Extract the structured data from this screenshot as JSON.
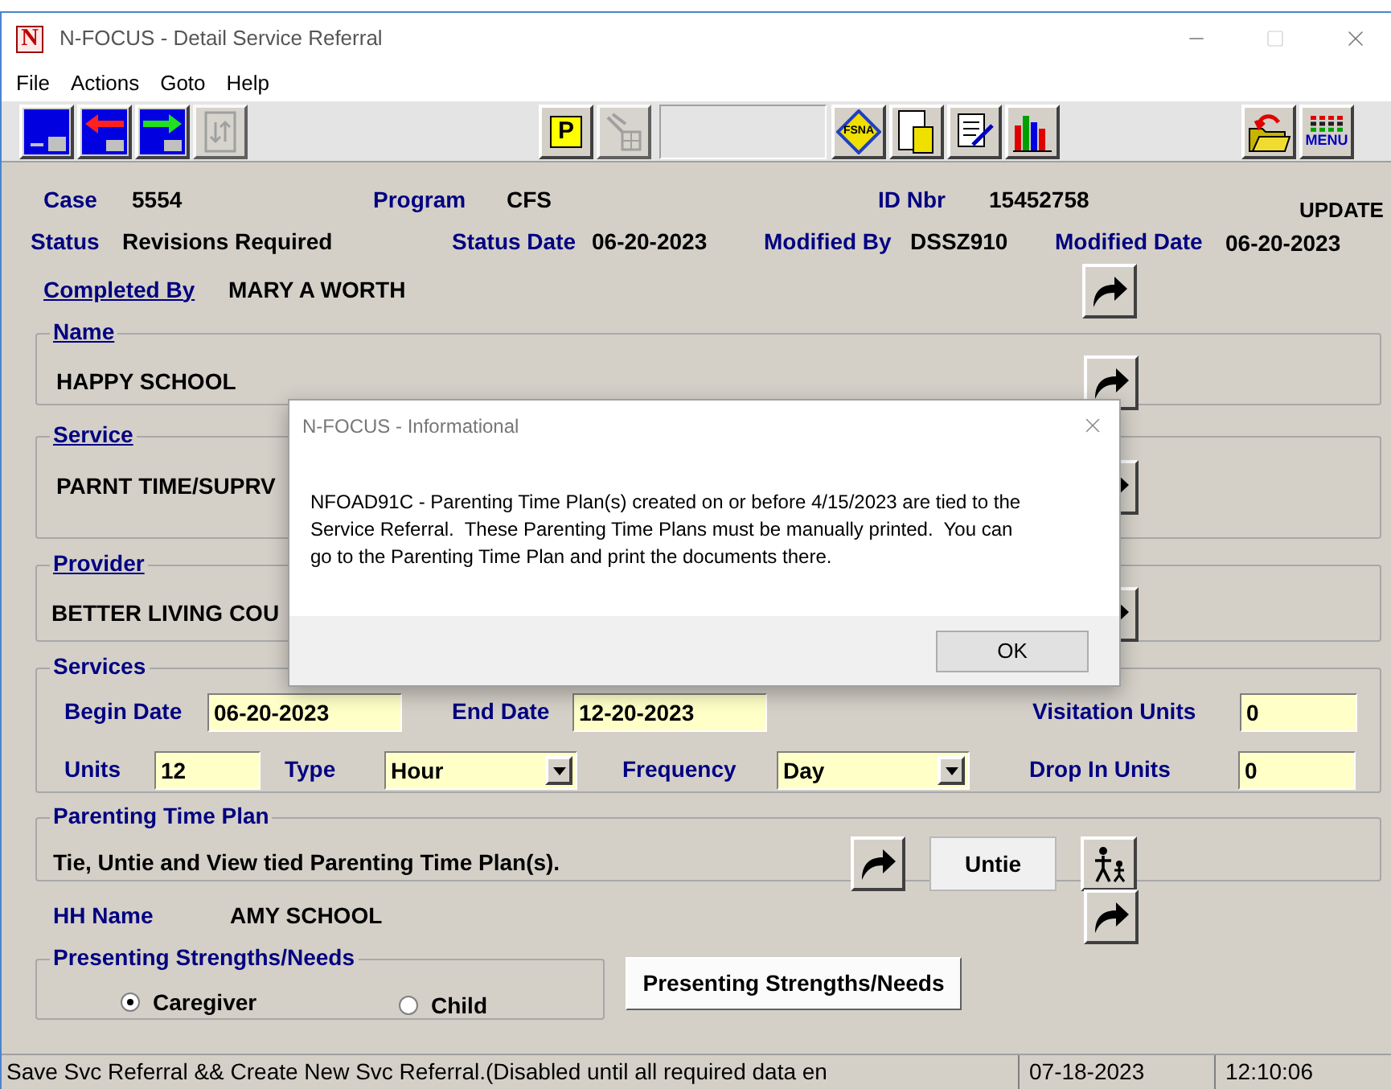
{
  "window": {
    "logo": "N",
    "title": "N-FOCUS - Detail Service Referral"
  },
  "menu": [
    {
      "label": "File"
    },
    {
      "label": "Actions"
    },
    {
      "label": "Goto"
    },
    {
      "label": "Help"
    }
  ],
  "toolbar": {
    "left": [
      {
        "kind": "save",
        "disabled": false
      },
      {
        "kind": "back",
        "disabled": false
      },
      {
        "kind": "forward",
        "disabled": false
      },
      {
        "kind": "swap",
        "disabled": true
      }
    ],
    "middle": [
      {
        "kind": "letter",
        "label": "P",
        "disabled": false
      },
      {
        "kind": "tool",
        "disabled": true
      }
    ],
    "tools": [
      {
        "kind": "diamond",
        "label": "FSNA",
        "disabled": false
      },
      {
        "kind": "document",
        "disabled": false
      },
      {
        "kind": "checklist",
        "disabled": false
      },
      {
        "kind": "chart",
        "disabled": false
      }
    ],
    "right": [
      {
        "kind": "folder",
        "disabled": false
      },
      {
        "kind": "menu",
        "label": "MENU",
        "disabled": false
      }
    ]
  },
  "case": {
    "label": "Case",
    "value": "5554"
  },
  "program": {
    "label": "Program",
    "value": "CFS"
  },
  "id_nbr": {
    "label": "ID Nbr",
    "value": "15452758"
  },
  "mode": "UPDATE",
  "status": {
    "label": "Status",
    "value": "Revisions Required"
  },
  "status_date": {
    "label": "Status Date",
    "value": "06-20-2023"
  },
  "modified_by": {
    "label": "Modified By",
    "value": "DSSZ910"
  },
  "modified_date": {
    "label": "Modified Date",
    "value": "06-20-2023"
  },
  "completed_by": {
    "label": "Completed By",
    "value": "MARY A WORTH"
  },
  "name": {
    "label": "Name",
    "value": "HAPPY SCHOOL"
  },
  "service": {
    "label": "Service",
    "value": "PARNT TIME/SUPRV"
  },
  "provider": {
    "label": "Provider",
    "value": "BETTER LIVING COU"
  },
  "services": {
    "label": "Services",
    "begin_date": {
      "label": "Begin Date",
      "value": "06-20-2023"
    },
    "end_date": {
      "label": "End Date",
      "value": "12-20-2023"
    },
    "visitation_units": {
      "label": "Visitation Units",
      "value": "0"
    },
    "units": {
      "label": "Units",
      "value": "12"
    },
    "type": {
      "label": "Type",
      "value": "Hour"
    },
    "frequency": {
      "label": "Frequency",
      "value": "Day"
    },
    "drop_in_units": {
      "label": "Drop In Units",
      "value": "0"
    }
  },
  "parenting_time_plan": {
    "label": "Parenting Time Plan",
    "text": "Tie, Untie and View tied Parenting Time Plan(s).",
    "button": "Untie"
  },
  "hh_name": {
    "label": "HH Name",
    "value": "AMY SCHOOL"
  },
  "presenting": {
    "label": "Presenting Strengths/Needs",
    "options": [
      {
        "label": "Caregiver",
        "selected": true
      },
      {
        "label": "Child",
        "selected": false
      }
    ],
    "button": "Presenting Strengths/Needs"
  },
  "status_bar": {
    "message": "Save Svc Referral && Create New Svc Referral.(Disabled until all required data en",
    "date": "07-18-2023",
    "time": "12:10:06"
  },
  "dialog": {
    "title": "N-FOCUS - Informational",
    "message": "NFOAD91C - Parenting Time Plan(s) created on or before 4/15/2023 are tied to the Service Referral.  These Parenting Time Plans must be manually printed.  You can go to the Parenting Time Plan and print the documents there.",
    "button": "OK"
  }
}
